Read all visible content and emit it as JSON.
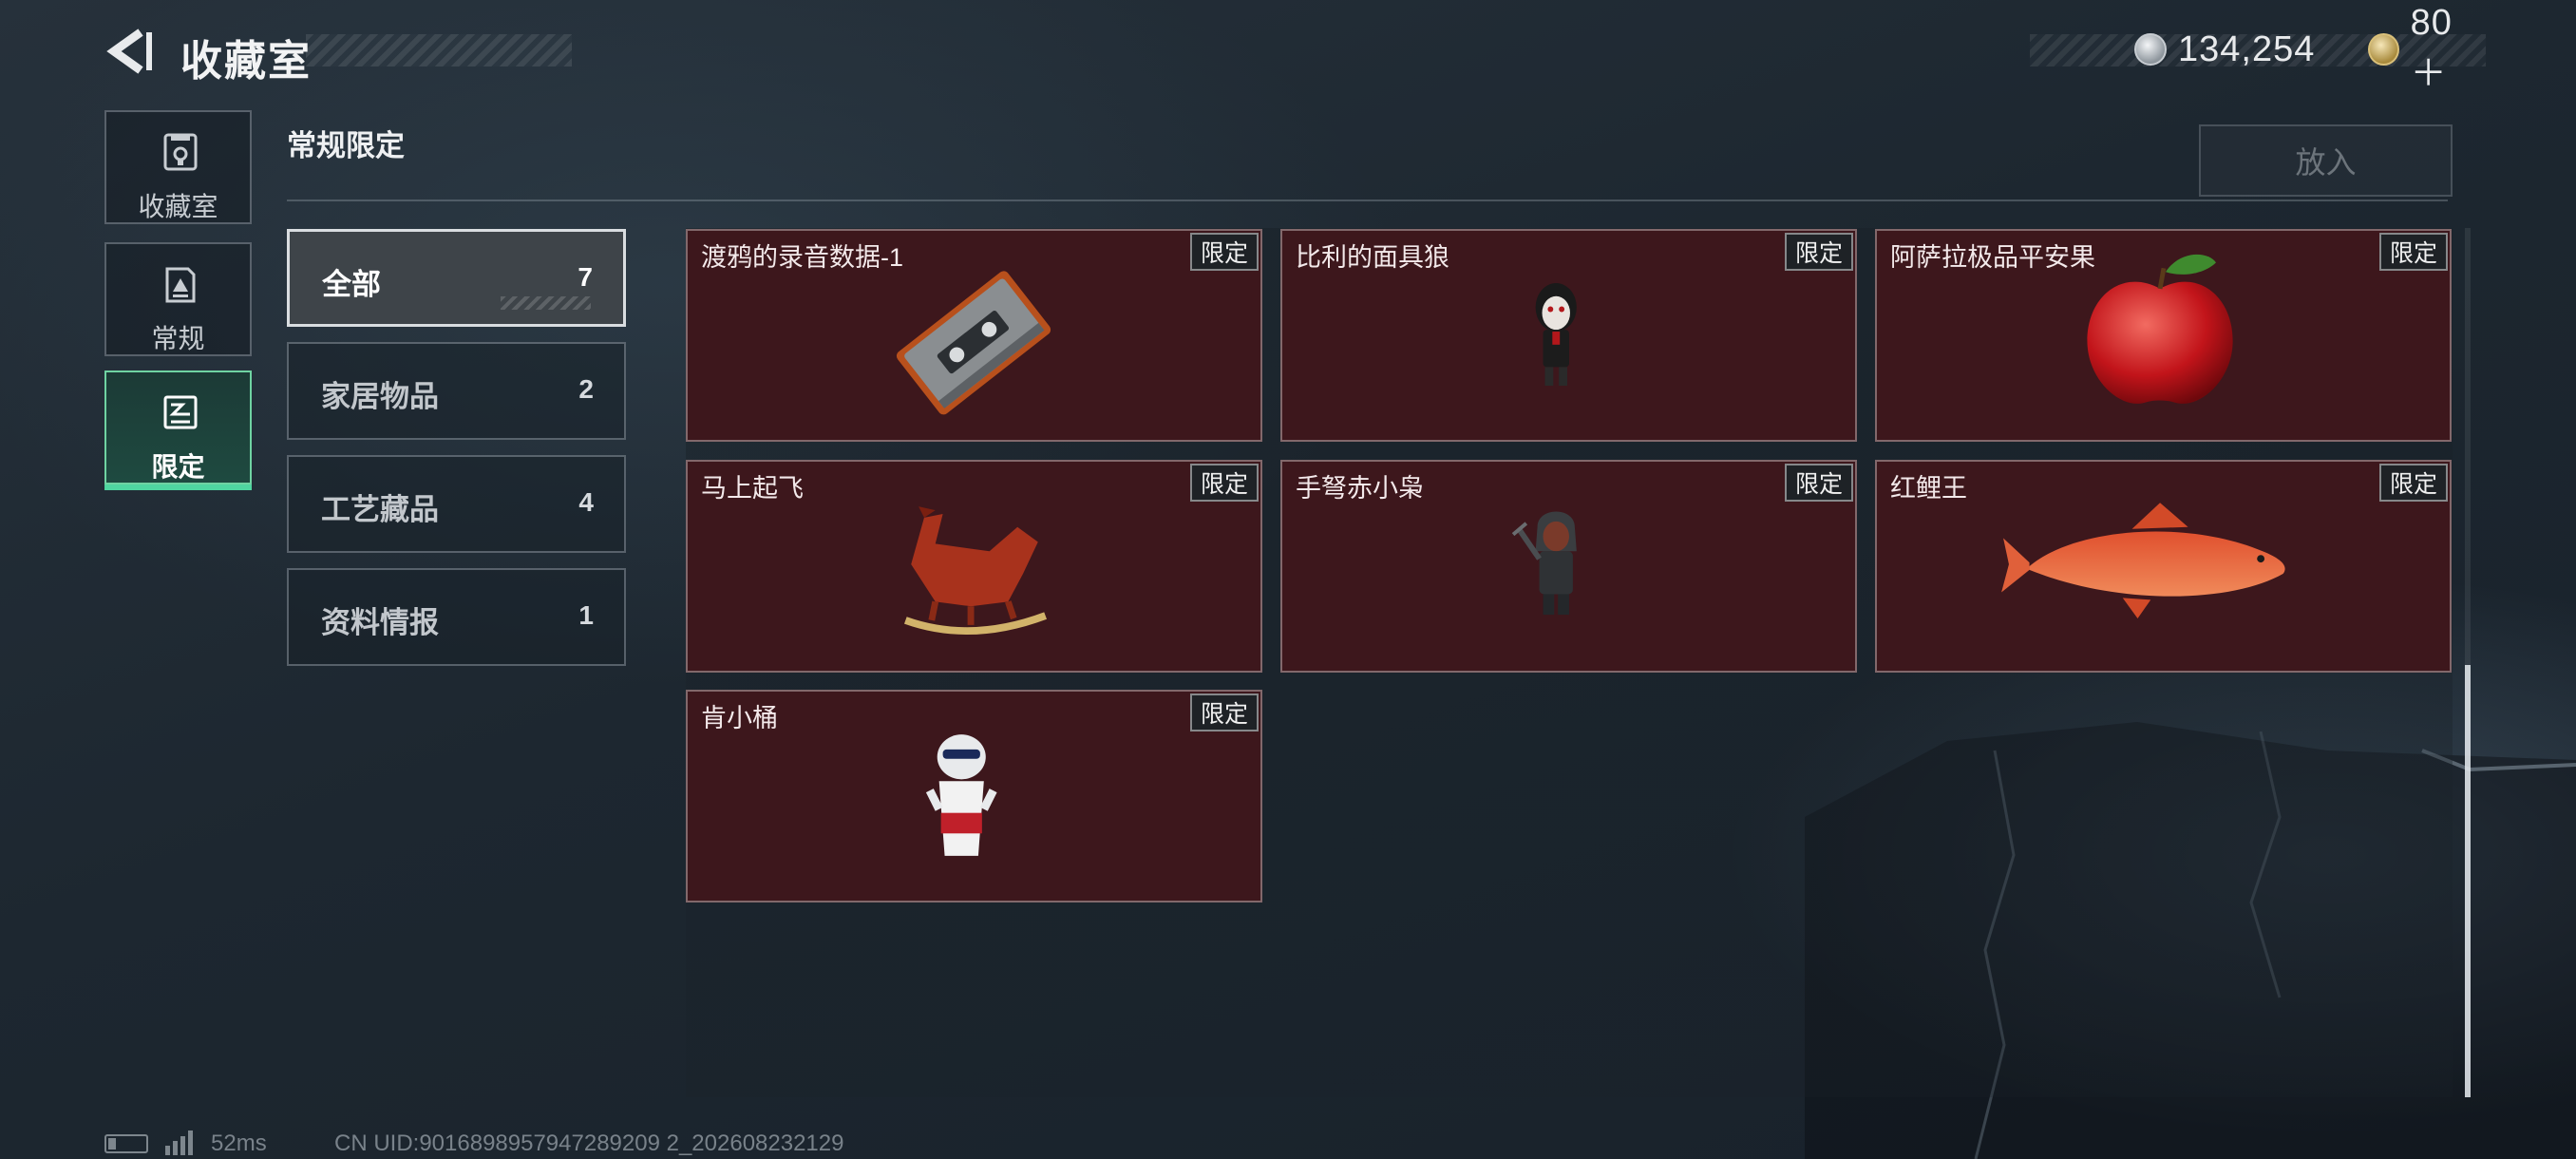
{
  "header": {
    "title": "收藏室",
    "currency": [
      {
        "icon": "silver-coin-icon",
        "value": "134,254"
      },
      {
        "icon": "gold-coin-icon",
        "value": "80＋"
      }
    ]
  },
  "left_nav": [
    {
      "icon": "collection-room-icon",
      "label": "收藏室",
      "active": false
    },
    {
      "icon": "regular-icon",
      "label": "常规",
      "active": false
    },
    {
      "icon": "limited-icon",
      "label": "限定",
      "active": true
    }
  ],
  "section": {
    "title": "常规限定",
    "put_button": "放入"
  },
  "categories": [
    {
      "label": "全部",
      "count": "7",
      "active": true
    },
    {
      "label": "家居物品",
      "count": "2",
      "active": false
    },
    {
      "label": "工艺藏品",
      "count": "4",
      "active": false
    },
    {
      "label": "资料情报",
      "count": "1",
      "active": false
    }
  ],
  "items": [
    {
      "name": "渡鸦的录音数据-1",
      "tag": "限定",
      "art": "cassette-tape-icon"
    },
    {
      "name": "比利的面具狼",
      "tag": "限定",
      "art": "puppet-figure-icon"
    },
    {
      "name": "阿萨拉极品平安果",
      "tag": "限定",
      "art": "apple-icon"
    },
    {
      "name": "马上起飞",
      "tag": "限定",
      "art": "rocking-horse-icon"
    },
    {
      "name": "手弩赤小枭",
      "tag": "限定",
      "art": "hooded-figure-icon"
    },
    {
      "name": "红鲤王",
      "tag": "限定",
      "art": "red-carp-icon"
    },
    {
      "name": "肯小桶",
      "tag": "限定",
      "art": "bucket-figure-icon"
    }
  ],
  "footer": {
    "ping": "52ms",
    "uid": "CN UID:9016898957947289209 2_202608232129"
  }
}
